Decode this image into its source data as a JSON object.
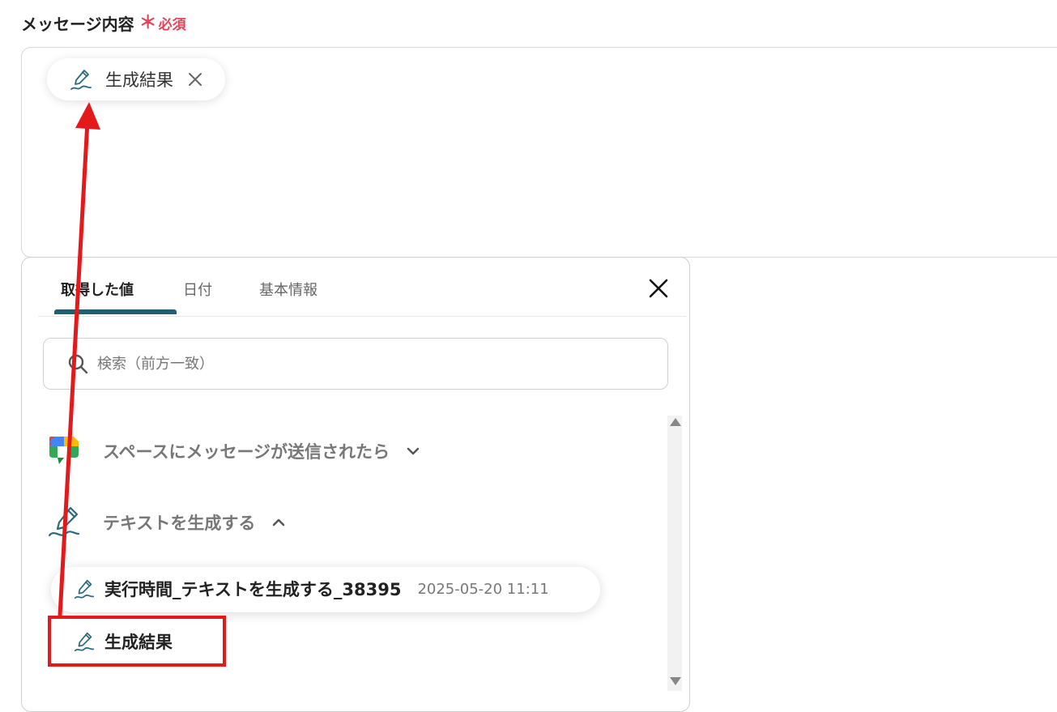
{
  "field": {
    "label": "メッセージ内容",
    "required_mark": "＊",
    "required_text": "必須"
  },
  "message_box": {
    "chip_label": "生成結果"
  },
  "popup": {
    "tabs": [
      {
        "label": "取得した値",
        "active": true
      },
      {
        "label": "日付",
        "active": false
      },
      {
        "label": "基本情報",
        "active": false
      }
    ],
    "search_placeholder": "検索（前方一致）",
    "sections": [
      {
        "label": "スペースにメッセージが送信されたら",
        "icon": "google-chat-icon",
        "expanded": false
      },
      {
        "label": "テキストを生成する",
        "icon": "pen-icon",
        "expanded": true
      }
    ],
    "items": [
      {
        "label": "実行時間_テキストを生成する_38395",
        "timestamp": "2025-05-20 11:11"
      },
      {
        "label": "生成結果",
        "timestamp": ""
      }
    ]
  },
  "colors": {
    "accent": "#1e5f73",
    "required": "#e2435a",
    "annotation": "#e3191c"
  }
}
